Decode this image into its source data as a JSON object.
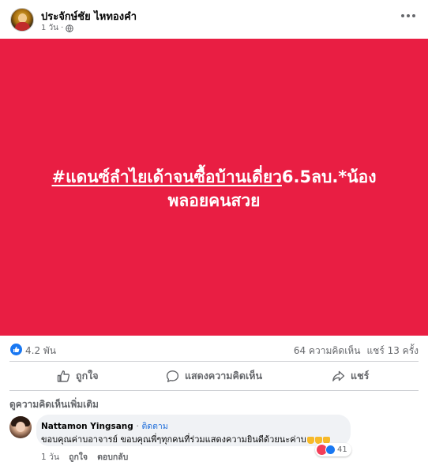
{
  "post": {
    "author": "ประจักษ์ชัย ไหทองคำ",
    "time": "1 วัน ·",
    "hero_line1_hashtag": "#แดนซ์ลำไยเด้าจนซื้อบ้านเดี่ยว",
    "hero_line1_rest": "6.5ลบ.*น้อง",
    "hero_line2": "พลอยคนสวย",
    "background_color": "#e91e43"
  },
  "stats": {
    "reactions": "4.2 พัน",
    "comments": "64 ความคิดเห็น",
    "shares": "แชร์ 13 ครั้ง"
  },
  "actions": {
    "like": "ถูกใจ",
    "comment": "แสดงความคิดเห็น",
    "share": "แชร์"
  },
  "more_comments": "ดูความคิดเห็นเพิ่มเติม",
  "comment": {
    "author": "Nattamon Yingsang",
    "separator": "·",
    "follow": "ติดตาม",
    "text": "ขอบคุณค่าบอาจารย์ ขอบคุณพี่ๆทุกคนที่ร่วมแสดงความยินดีด้วยนะค่าบ",
    "reaction_count": "41",
    "time": "1 วัน",
    "like": "ถูกใจ",
    "reply": "ตอบกลับ"
  },
  "colors": {
    "accent": "#1877f2",
    "love": "#f33e58"
  },
  "icons": [
    "globe-icon",
    "more-icon",
    "like-icon",
    "comment-icon",
    "share-icon",
    "love-icon",
    "pray-emoji"
  ]
}
